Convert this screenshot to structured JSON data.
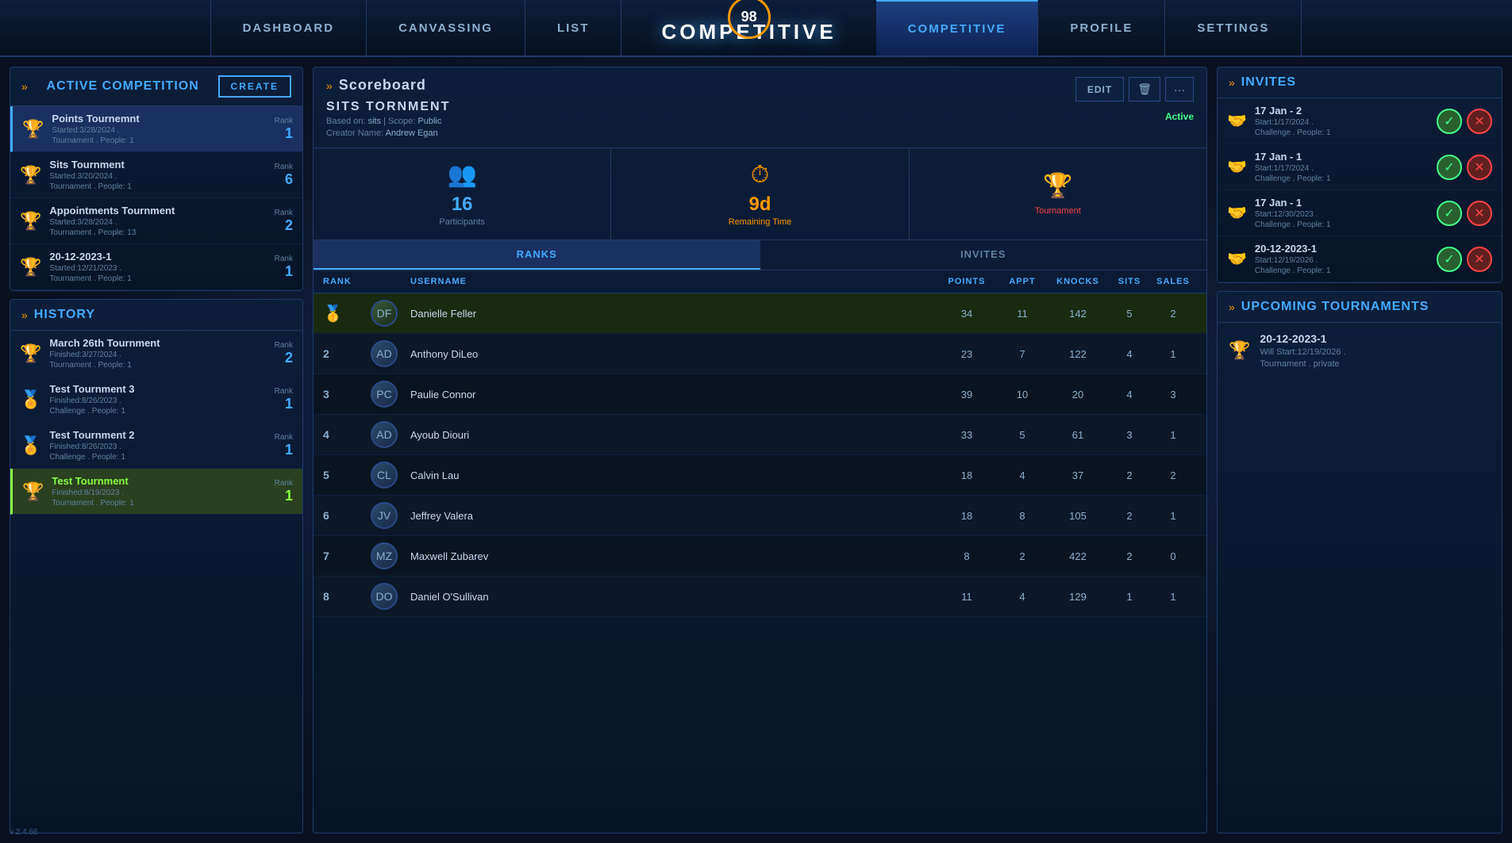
{
  "nav": {
    "items": [
      {
        "label": "DASHBOARD",
        "id": "dashboard"
      },
      {
        "label": "CANVASSING",
        "id": "canvassing"
      },
      {
        "label": "LIST",
        "id": "list"
      },
      {
        "label": "COMPETITIVE",
        "id": "competitive",
        "active": true
      },
      {
        "label": "PROFILE",
        "id": "profile"
      },
      {
        "label": "SETTINGS",
        "id": "settings"
      }
    ],
    "center": {
      "badge": "98",
      "title": "COMPETITIVE"
    }
  },
  "left": {
    "active_competition": {
      "header": "Active Competition",
      "create_btn": "CREATE",
      "items": [
        {
          "name": "Points Tournemnt",
          "started": "Started:3/28/2024 .",
          "type": "Tournament . People: 1",
          "rank": "1",
          "trophy": "gold"
        },
        {
          "name": "Sits Tournment",
          "started": "Started:3/20/2024 .",
          "type": "Tournament . People: 1",
          "rank": "6",
          "trophy": "gold"
        },
        {
          "name": "Appointments Tournment",
          "started": "Started:3/28/2024 .",
          "type": "Tournament . People: 13",
          "rank": "2",
          "trophy": "gold"
        },
        {
          "name": "20-12-2023-1",
          "started": "Started:12/21/2023 .",
          "type": "Tournament . People: 1",
          "rank": "1",
          "trophy": "gold"
        }
      ]
    },
    "history": {
      "header": "History",
      "items": [
        {
          "name": "March 26th Tournment",
          "finished": "Finished:3/27/2024 .",
          "type": "Tournament . People: 1",
          "rank": "2",
          "trophy": "gold",
          "highlighted": false
        },
        {
          "name": "Test Tournment 3",
          "finished": "Finished:8/26/2023 .",
          "type": "Challenge . People: 1",
          "rank": "1",
          "trophy": "challenge",
          "highlighted": false
        },
        {
          "name": "Test Tournment 2",
          "finished": "Finished:8/26/2023 .",
          "type": "Challenge . People: 1",
          "rank": "1",
          "trophy": "challenge",
          "highlighted": false
        },
        {
          "name": "Test Tournment",
          "finished": "Finished:8/19/2023 .",
          "type": "Tournament . People: 1",
          "rank": "1",
          "trophy": "gold",
          "highlighted": true
        }
      ]
    }
  },
  "scoreboard": {
    "header": "Scoreboard",
    "tournament": {
      "title": "SITS TORNMENT",
      "based_on": "sits",
      "scope": "Public",
      "creator": "Andrew Egan",
      "status": "Active"
    },
    "stats": {
      "participants": {
        "value": "16",
        "label": "Participants"
      },
      "remaining": {
        "value": "9d",
        "label": "Remaining Time"
      },
      "tournament": {
        "label": "Tournament"
      }
    },
    "tabs": [
      {
        "label": "Ranks",
        "active": true
      },
      {
        "label": "Invites",
        "active": false
      }
    ],
    "columns": [
      "RANK",
      "USERNAME",
      "POINTS",
      "APPT",
      "KNOCKS",
      "SITS",
      "SALES"
    ],
    "rows": [
      {
        "rank": "1",
        "username": "Danielle Feller",
        "points": "34",
        "appt": "11",
        "knocks": "142",
        "sits": "5",
        "sales": "2"
      },
      {
        "rank": "2",
        "username": "Anthony DiLeo",
        "points": "23",
        "appt": "7",
        "knocks": "122",
        "sits": "4",
        "sales": "1"
      },
      {
        "rank": "3",
        "username": "Paulie Connor",
        "points": "39",
        "appt": "10",
        "knocks": "20",
        "sits": "4",
        "sales": "3"
      },
      {
        "rank": "4",
        "username": "Ayoub Diouri",
        "points": "33",
        "appt": "5",
        "knocks": "61",
        "sits": "3",
        "sales": "1"
      },
      {
        "rank": "5",
        "username": "Calvin Lau",
        "points": "18",
        "appt": "4",
        "knocks": "37",
        "sits": "2",
        "sales": "2"
      },
      {
        "rank": "6",
        "username": "Jeffrey Valera",
        "points": "18",
        "appt": "8",
        "knocks": "105",
        "sits": "2",
        "sales": "1"
      },
      {
        "rank": "7",
        "username": "Maxwell Zubarev",
        "points": "8",
        "appt": "2",
        "knocks": "422",
        "sits": "2",
        "sales": "0"
      },
      {
        "rank": "8",
        "username": "Daniel O'Sullivan",
        "points": "11",
        "appt": "4",
        "knocks": "129",
        "sits": "1",
        "sales": "1"
      }
    ],
    "buttons": {
      "edit": "EDIT",
      "delete": "🗑",
      "more": "···"
    }
  },
  "right": {
    "invites": {
      "header": "Invites",
      "items": [
        {
          "name": "17 Jan - 2",
          "start": "Start:1/17/2024 .",
          "type": "Challenge . People: 1"
        },
        {
          "name": "17 Jan - 1",
          "start": "Start:1/17/2024 .",
          "type": "Challenge . People: 1"
        },
        {
          "name": "17 Jan - 1",
          "start": "Start:12/30/2023 .",
          "type": "Challenge . People: 1"
        },
        {
          "name": "20-12-2023-1",
          "start": "Start:12/19/2026 .",
          "type": "Challenge . People: 1"
        }
      ]
    },
    "upcoming": {
      "header": "Upcoming tournaments",
      "items": [
        {
          "name": "20-12-2023-1",
          "will_start": "Will Start:12/19/2026 .",
          "type": "Tournament . private"
        }
      ]
    }
  },
  "version": "v 2.4.66"
}
